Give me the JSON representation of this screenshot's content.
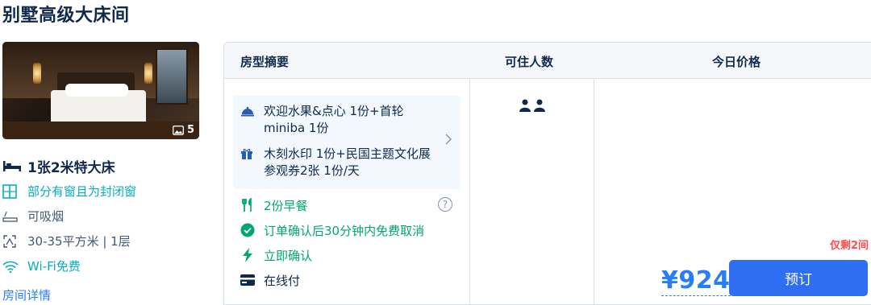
{
  "room": {
    "title": "别墅高级大床间",
    "photo_count": "5",
    "bed": "1张2米特大床",
    "window": "部分有窗且为封闭窗",
    "smoking": "可吸烟",
    "area_floor": "30-35平方米 | 1层",
    "wifi": "Wi-Fi免费",
    "detail_link": "房间详情"
  },
  "table": {
    "headers": [
      "房型摘要",
      "可住人数",
      "今日价格"
    ],
    "gifts": [
      {
        "icon": "food-cloche-icon",
        "text": "欢迎水果&点心 1份+首轮miniba 1份"
      },
      {
        "icon": "gift-icon",
        "text": "木刻水印 1份+民国主题文化展参观券2张 1份/天"
      }
    ],
    "services": [
      {
        "icon": "fork-knife-icon",
        "text": "2份早餐"
      },
      {
        "icon": "check-circle-icon",
        "text": "订单确认后30分钟内免费取消"
      },
      {
        "icon": "lightning-icon",
        "text": "立即确认"
      },
      {
        "icon": "credit-card-icon",
        "text": "在线付"
      }
    ],
    "guests": 2,
    "remaining": "仅剩2间",
    "price": "¥924",
    "book_label": "预订"
  },
  "colors": {
    "accent": "#287dfa",
    "button": "#2d6ff0",
    "green": "#00a86b",
    "teal": "#06aebd",
    "alert": "#ff4d4f"
  }
}
